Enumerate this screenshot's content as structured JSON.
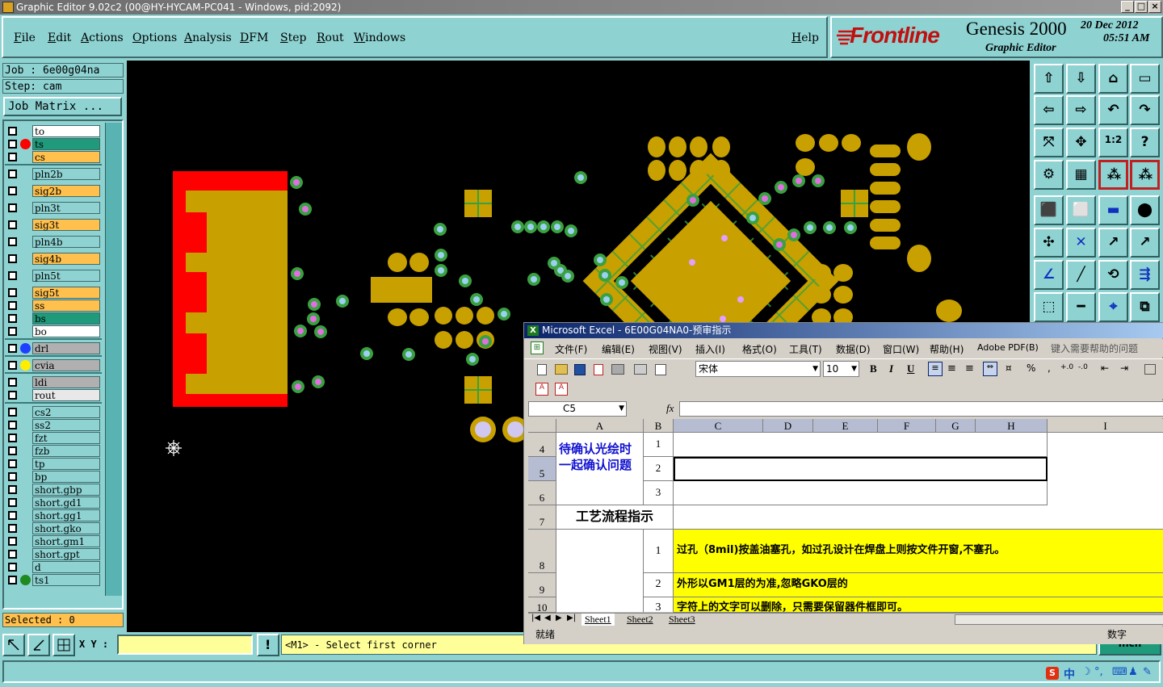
{
  "window": {
    "title": "Graphic Editor 9.02c2 (00@HY-HYCAM-PC041 - Windows, pid:2092)"
  },
  "menu": {
    "items": [
      "File",
      "Edit",
      "Actions",
      "Options",
      "Analysis",
      "DFM",
      "Step",
      "Rout",
      "Windows"
    ],
    "help": "Help"
  },
  "brand": {
    "logo": "Frontline",
    "product": "Genesis 2000",
    "subtitle": "Graphic Editor",
    "date": "20 Dec 2012",
    "time": "05:51 AM"
  },
  "job": {
    "job_label": "Job : 6e00g04na",
    "step_label": "Step: cam",
    "matrix_button": "Job Matrix ..."
  },
  "layers": [
    {
      "name": "to",
      "color": "#ffffff",
      "dot": ""
    },
    {
      "name": "ts",
      "color": "#1f9a7a",
      "dot": "#ff0000"
    },
    {
      "name": "cs",
      "color": "#ffc04d",
      "dot": ""
    },
    {
      "name": "pln2b",
      "color": "#8ed2d2",
      "dot": ""
    },
    {
      "name": "sig2b",
      "color": "#ffc04d",
      "dot": ""
    },
    {
      "name": "pln3t",
      "color": "#8ed2d2",
      "dot": ""
    },
    {
      "name": "sig3t",
      "color": "#ffc04d",
      "dot": ""
    },
    {
      "name": "pln4b",
      "color": "#8ed2d2",
      "dot": ""
    },
    {
      "name": "sig4b",
      "color": "#ffc04d",
      "dot": ""
    },
    {
      "name": "pln5t",
      "color": "#8ed2d2",
      "dot": ""
    },
    {
      "name": "sig5t",
      "color": "#ffc04d",
      "dot": ""
    },
    {
      "name": "ss",
      "color": "#ffc04d",
      "dot": ""
    },
    {
      "name": "bs",
      "color": "#1f9a7a",
      "dot": ""
    },
    {
      "name": "bo",
      "color": "#ffffff",
      "dot": ""
    },
    {
      "name": "drl",
      "color": "#b0b0b0",
      "dot": "#2040ff"
    },
    {
      "name": "cvia",
      "color": "#b0b0b0",
      "dot": "#ffee00"
    },
    {
      "name": "ldi",
      "color": "#b0b0b0",
      "dot": ""
    },
    {
      "name": "rout",
      "color": "#e8e8e8",
      "dot": ""
    },
    {
      "name": "cs2",
      "color": "#8ed2d2",
      "dot": ""
    },
    {
      "name": "ss2",
      "color": "#8ed2d2",
      "dot": ""
    },
    {
      "name": "fzt",
      "color": "#8ed2d2",
      "dot": ""
    },
    {
      "name": "fzb",
      "color": "#8ed2d2",
      "dot": ""
    },
    {
      "name": "tp",
      "color": "#8ed2d2",
      "dot": ""
    },
    {
      "name": "bp",
      "color": "#8ed2d2",
      "dot": ""
    },
    {
      "name": "short.gbp",
      "color": "#8ed2d2",
      "dot": ""
    },
    {
      "name": "short.gd1",
      "color": "#8ed2d2",
      "dot": ""
    },
    {
      "name": "short.gg1",
      "color": "#8ed2d2",
      "dot": ""
    },
    {
      "name": "short.gko",
      "color": "#8ed2d2",
      "dot": ""
    },
    {
      "name": "short.gm1",
      "color": "#8ed2d2",
      "dot": ""
    },
    {
      "name": "short.gpt",
      "color": "#8ed2d2",
      "dot": ""
    },
    {
      "name": "d",
      "color": "#8ed2d2",
      "dot": ""
    },
    {
      "name": "ts1",
      "color": "#8ed2d2",
      "dot": "#1f8a1f"
    }
  ],
  "selected": "Selected : 0",
  "bottom": {
    "xy_label": "X Y :",
    "xy_value": "",
    "prompt": "<M1> - Select first corner",
    "units": "Inch"
  },
  "excel": {
    "title": "Microsoft Excel - 6E00G04NA0-预审指示",
    "menu": [
      "文件(F)",
      "编辑(E)",
      "视图(V)",
      "插入(I)",
      "格式(O)",
      "工具(T)",
      "数据(D)",
      "窗口(W)",
      "帮助(H)",
      "Adobe PDF(B)"
    ],
    "help_box": "键入需要帮助的问题",
    "font": "宋体",
    "font_size": "10",
    "name_box": "C5",
    "fx": "fx",
    "columns": [
      "A",
      "B",
      "C",
      "D",
      "E",
      "F",
      "G",
      "H",
      "I"
    ],
    "rows": [
      "4",
      "5",
      "6",
      "7",
      "8",
      "9",
      "10"
    ],
    "a4": "待确认光绘时一起确认问题",
    "b_nums": [
      "1",
      "2",
      "3"
    ],
    "a7": "工艺流程指示",
    "b8": "1",
    "c8": "过孔（8mil)按盖油塞孔，如过孔设计在焊盘上则按文件开窗,不塞孔。",
    "b9": "2",
    "c9": "外形以GM1层的为准,忽略GKO层的",
    "b10": "3",
    "c10": "字符上的文字可以删除，只需要保留器件框即可。",
    "sheets": [
      "Sheet1",
      "Sheet2",
      "Sheet3"
    ],
    "status": "就绪",
    "status_right": "数字",
    "pct": "%"
  },
  "colors": {
    "gold": "#c8a000",
    "red": "#ff0000",
    "green": "#3aa040",
    "teal": "#8ed2d2"
  },
  "tray": {
    "ime": "中"
  }
}
